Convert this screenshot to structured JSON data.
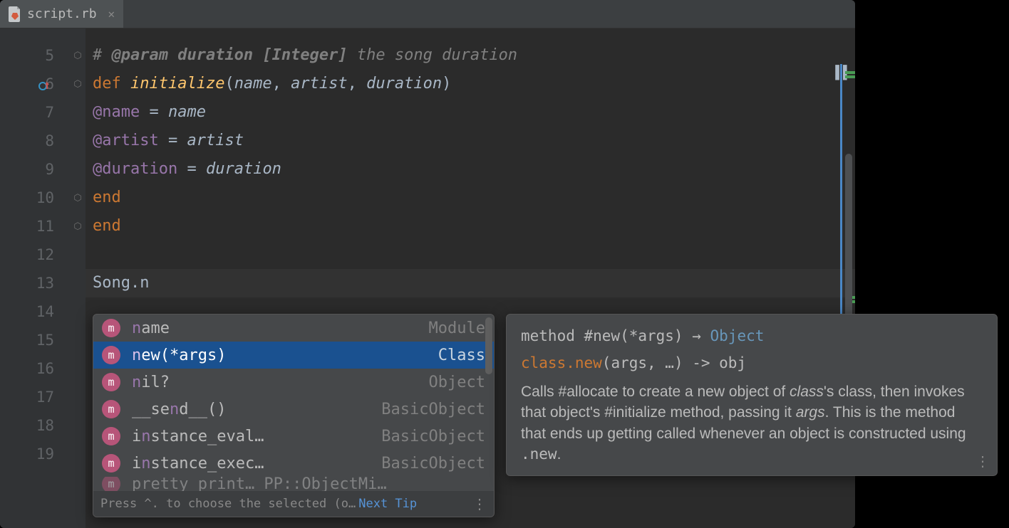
{
  "tab": {
    "filename": "script.rb"
  },
  "gutter": {
    "lines": [
      5,
      6,
      7,
      8,
      9,
      10,
      11,
      12,
      13,
      14,
      15,
      16,
      17,
      18,
      19
    ]
  },
  "code": {
    "l5_comment": "# ",
    "l5_tag": "@param duration [Integer]",
    "l5_desc": " the song duration",
    "l6_def": "def ",
    "l6_name": "initialize",
    "l6_p1": "name",
    "l6_p2": "artist",
    "l6_p3": "duration",
    "l7_ivar": "@name",
    "l7_eq": " = ",
    "l7_val": "name",
    "l8_ivar": "@artist",
    "l8_eq": " = ",
    "l8_val": "artist",
    "l9_ivar": "@duration",
    "l9_eq": " = ",
    "l9_val": "duration",
    "l10": "end",
    "l11": "end",
    "l13_const": "Song",
    "l13_dot": ".",
    "l13_typed": "n"
  },
  "completion": {
    "items": [
      {
        "match": "n",
        "rest": "ame",
        "hint": "Module"
      },
      {
        "match": "n",
        "rest": "ew(*args)",
        "hint": "Class"
      },
      {
        "match": "n",
        "rest": "il?",
        "hint": "Object"
      },
      {
        "pre": "__se",
        "match": "n",
        "rest": "d__()",
        "hint": "BasicObject"
      },
      {
        "pre": "i",
        "match": "n",
        "rest": "stance_eval…",
        "hint": "BasicObject"
      },
      {
        "pre": "i",
        "match": "n",
        "rest": "stance_exec…",
        "hint": "BasicObject"
      },
      {
        "partial": "pretty_print…  PP::ObjectMi…"
      }
    ],
    "footer_text": "Press ^. to choose the selected (o…",
    "footer_link": "Next Tip"
  },
  "doc": {
    "sig_prefix": "method #new(*args) → ",
    "sig_ret": "Object",
    "syntax_call": "class.new",
    "syntax_args": "(args, …) -> obj",
    "body_1": "Calls #allocate to create a new object of ",
    "body_em1": "class",
    "body_2": "'s class, then invokes that object's #initialize method, passing it ",
    "body_em2": "args",
    "body_3": ". This is the method that ends up getting called whenever an object is constructed using ",
    "body_code": ".new",
    "body_4": "."
  }
}
